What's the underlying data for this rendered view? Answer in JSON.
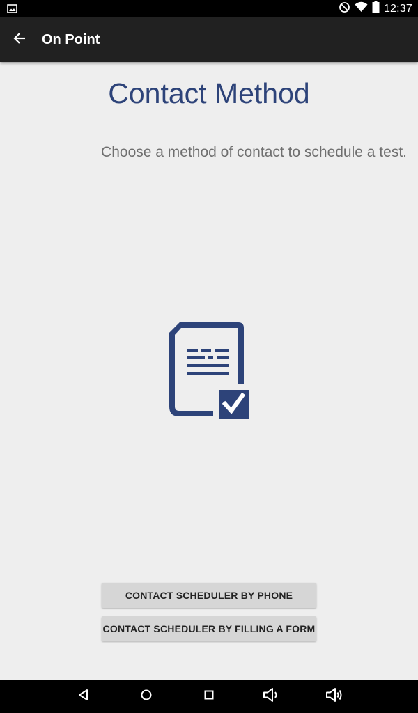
{
  "status_bar": {
    "time": "12:37",
    "icons": [
      "image-notification-icon",
      "do-not-disturb-icon",
      "wifi-icon",
      "battery-icon"
    ]
  },
  "toolbar": {
    "title": "On Point",
    "back_icon": "arrow-back-icon"
  },
  "main": {
    "title": "Contact Method",
    "subtitle": "Choose a method of contact to schedule a test.",
    "illustration_icon": "document-checked-icon",
    "buttons": [
      {
        "label": "CONTACT SCHEDULER BY PHONE"
      },
      {
        "label": "CONTACT SCHEDULER BY FILLING A FORM"
      }
    ]
  },
  "nav_bar": {
    "icons": [
      "back-triangle-icon",
      "home-circle-icon",
      "recents-square-icon",
      "volume-down-icon",
      "volume-up-icon"
    ]
  },
  "colors": {
    "accent": "#2d4379",
    "toolbar": "#212121",
    "background": "#eeeeee",
    "button": "#d6d6d6"
  }
}
